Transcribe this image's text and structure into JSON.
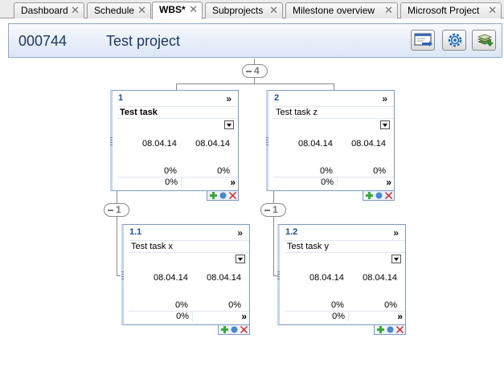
{
  "tabs": [
    {
      "label": "Dashboard",
      "active": false
    },
    {
      "label": "Schedule",
      "active": false
    },
    {
      "label": "WBS*",
      "active": true
    },
    {
      "label": "Subprojects",
      "active": false
    },
    {
      "label": "Milestone overview",
      "active": false
    },
    {
      "label": "Microsoft Project",
      "active": false
    }
  ],
  "close_glyph": "✕",
  "header": {
    "project_number": "000744",
    "project_name": "Test project",
    "buttons": [
      "export-icon",
      "gear-icon",
      "stack-icon"
    ]
  },
  "root_collapse": "4",
  "tasks": [
    {
      "wbs": "1",
      "name": "Test task",
      "bold": true,
      "start": "08.04.14",
      "end": "08.04.14",
      "pct1": "0%",
      "pct2": "0%",
      "field": "0%",
      "more": "»",
      "collapse": "1"
    },
    {
      "wbs": "2",
      "name": "Test task z",
      "bold": false,
      "start": "08.04.14",
      "end": "08.04.14",
      "pct1": "0%",
      "pct2": "0%",
      "field": "0%",
      "more": "»",
      "collapse": "1"
    },
    {
      "wbs": "1.1",
      "name": "Test task x",
      "bold": false,
      "start": "08.04.14",
      "end": "08.04.14",
      "pct1": "0%",
      "pct2": "0%",
      "field": "0%",
      "more": "»"
    },
    {
      "wbs": "1.2",
      "name": "Test task y",
      "bold": false,
      "start": "08.04.14",
      "end": "08.04.14",
      "pct1": "0%",
      "pct2": "0%",
      "field": "0%",
      "more": "»"
    }
  ],
  "colors": {
    "accent": "#1f3763",
    "card_border": "#7b9ac4",
    "add": "#3aa83a",
    "delete": "#d42020"
  }
}
